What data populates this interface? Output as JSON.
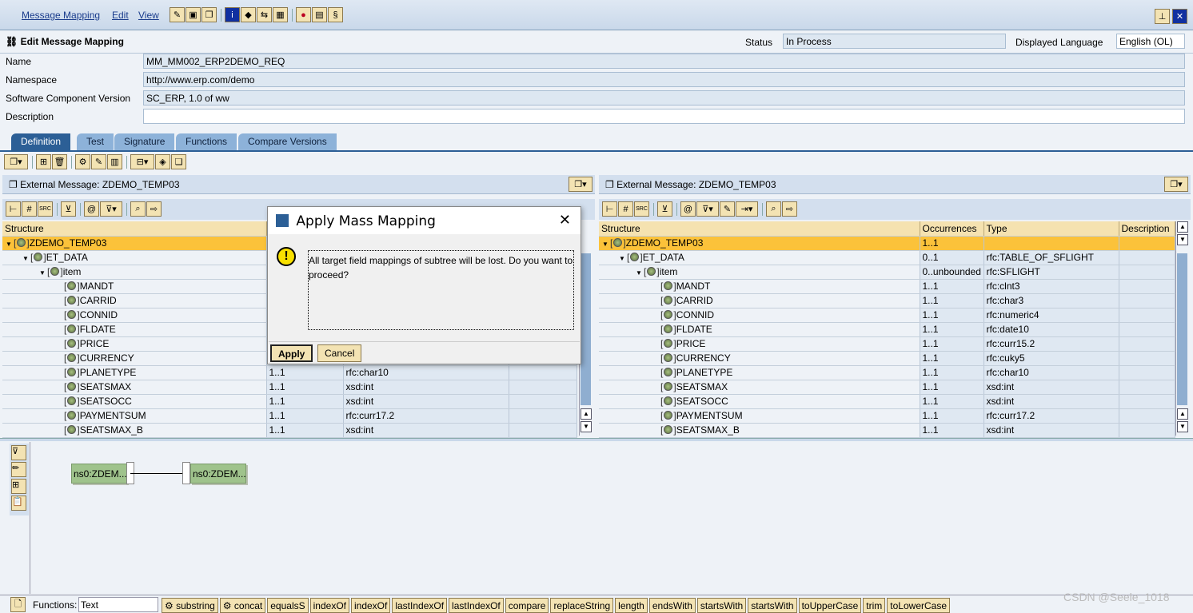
{
  "menu": [
    "Message Mapping",
    "Edit",
    "View"
  ],
  "header": {
    "title": "Edit Message Mapping",
    "status_label": "Status",
    "status_value": "In Process",
    "lang_label": "Displayed Language",
    "lang_value": "English (OL)"
  },
  "form": {
    "name_label": "Name",
    "name_value": "MM_MM002_ERP2DEMO_REQ",
    "ns_label": "Namespace",
    "ns_value": "http://www.erp.com/demo",
    "scv_label": "Software Component Version",
    "scv_value": "SC_ERP, 1.0 of ww",
    "desc_label": "Description",
    "desc_value": ""
  },
  "tabs": [
    "Definition",
    "Test",
    "Signature",
    "Functions",
    "Compare Versions"
  ],
  "left": {
    "title": "External Message: ZDEMO_TEMP03",
    "columns": [
      "Structure",
      "Occurrences",
      "Type",
      "Description"
    ],
    "rows": [
      [
        "ZDEMO_TEMP03",
        "",
        "",
        ""
      ],
      [
        "ET_DATA",
        "",
        "",
        ""
      ],
      [
        "item",
        "",
        "",
        ""
      ],
      [
        "MANDT",
        "",
        "",
        ""
      ],
      [
        "CARRID",
        "",
        "",
        ""
      ],
      [
        "CONNID",
        "",
        "",
        ""
      ],
      [
        "FLDATE",
        "",
        "",
        ""
      ],
      [
        "PRICE",
        "",
        "",
        ""
      ],
      [
        "CURRENCY",
        "",
        "",
        ""
      ],
      [
        "PLANETYPE",
        "1..1",
        "rfc:char10",
        ""
      ],
      [
        "SEATSMAX",
        "1..1",
        "xsd:int",
        ""
      ],
      [
        "SEATSOCC",
        "1..1",
        "xsd:int",
        ""
      ],
      [
        "PAYMENTSUM",
        "1..1",
        "rfc:curr17.2",
        ""
      ],
      [
        "SEATSMAX_B",
        "1..1",
        "xsd:int",
        ""
      ]
    ]
  },
  "right": {
    "title": "External Message: ZDEMO_TEMP03",
    "columns": [
      "Structure",
      "Occurrences",
      "Type",
      "Description"
    ],
    "rows": [
      [
        "ZDEMO_TEMP03",
        "1..1",
        "",
        ""
      ],
      [
        "ET_DATA",
        "0..1",
        "rfc:TABLE_OF_SFLIGHT",
        ""
      ],
      [
        "item",
        "0..unbounded",
        "rfc:SFLIGHT",
        ""
      ],
      [
        "MANDT",
        "1..1",
        "rfc:clnt3",
        ""
      ],
      [
        "CARRID",
        "1..1",
        "rfc:char3",
        ""
      ],
      [
        "CONNID",
        "1..1",
        "rfc:numeric4",
        ""
      ],
      [
        "FLDATE",
        "1..1",
        "rfc:date10",
        ""
      ],
      [
        "PRICE",
        "1..1",
        "rfc:curr15.2",
        ""
      ],
      [
        "CURRENCY",
        "1..1",
        "rfc:cuky5",
        ""
      ],
      [
        "PLANETYPE",
        "1..1",
        "rfc:char10",
        ""
      ],
      [
        "SEATSMAX",
        "1..1",
        "xsd:int",
        ""
      ],
      [
        "SEATSOCC",
        "1..1",
        "xsd:int",
        ""
      ],
      [
        "PAYMENTSUM",
        "1..1",
        "rfc:curr17.2",
        ""
      ],
      [
        "SEATSMAX_B",
        "1..1",
        "xsd:int",
        ""
      ]
    ]
  },
  "levels": [
    0,
    1,
    2,
    3,
    3,
    3,
    3,
    3,
    3,
    3,
    3,
    3,
    3,
    3
  ],
  "graph": {
    "source": "ns0:ZDEM...",
    "target": "ns0:ZDEM..."
  },
  "dialog": {
    "title": "Apply Mass Mapping",
    "message": "All target field mappings of subtree will be lost. Do you want to proceed?",
    "apply": "Apply",
    "cancel": "Cancel"
  },
  "functions": {
    "label": "Functions:",
    "category": "Text",
    "items": [
      "substring",
      "concat",
      "equalsS",
      "indexOf",
      "indexOf",
      "lastIndexOf",
      "lastIndexOf",
      "compare",
      "replaceString",
      "length",
      "endsWith",
      "startsWith",
      "startsWith",
      "toUpperCase",
      "trim",
      "toLowerCase"
    ]
  },
  "watermark": "CSDN @Seele_1018"
}
